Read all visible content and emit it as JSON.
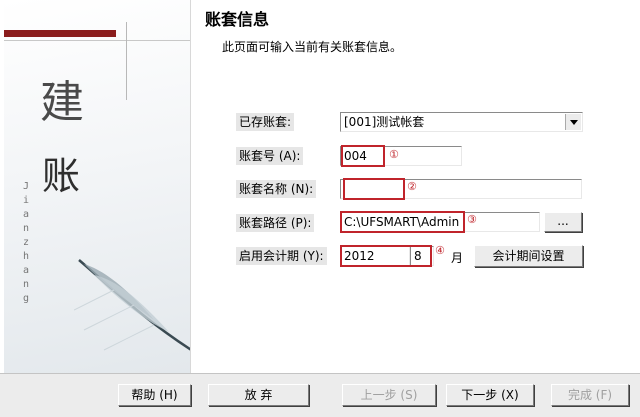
{
  "art": {
    "char_top": "建",
    "char_bottom": "账",
    "vertical_text": "Jianzhang"
  },
  "header": {
    "title": "账套信息",
    "subtitle": "此页面可输入当前有关账套信息。"
  },
  "form": {
    "existing_label": "已存账套:",
    "existing_value": "[001]测试帐套",
    "number_label": "账套号 (A):",
    "number_value": "004",
    "name_label": "账套名称 (N):",
    "name_value": "",
    "path_label": "账套路径 (P):",
    "path_value": "C:\\UFSMART\\Admin",
    "browse_label": "...",
    "period_label": "启用会计期 (Y):",
    "year_value": "2012",
    "month_value": "8",
    "month_unit": "月",
    "period_settings_label": "会计期间设置"
  },
  "markers": {
    "m1": "①",
    "m2": "②",
    "m3": "③",
    "m4": "④"
  },
  "footer": {
    "help": "帮助 (H)",
    "abandon": "放 弃",
    "prev": "上一步 (S)",
    "next": "下一步 (X)",
    "finish": "完成 (F)"
  },
  "colors": {
    "annotation_red": "#c0242b",
    "banner_red": "#8b1d1d"
  }
}
